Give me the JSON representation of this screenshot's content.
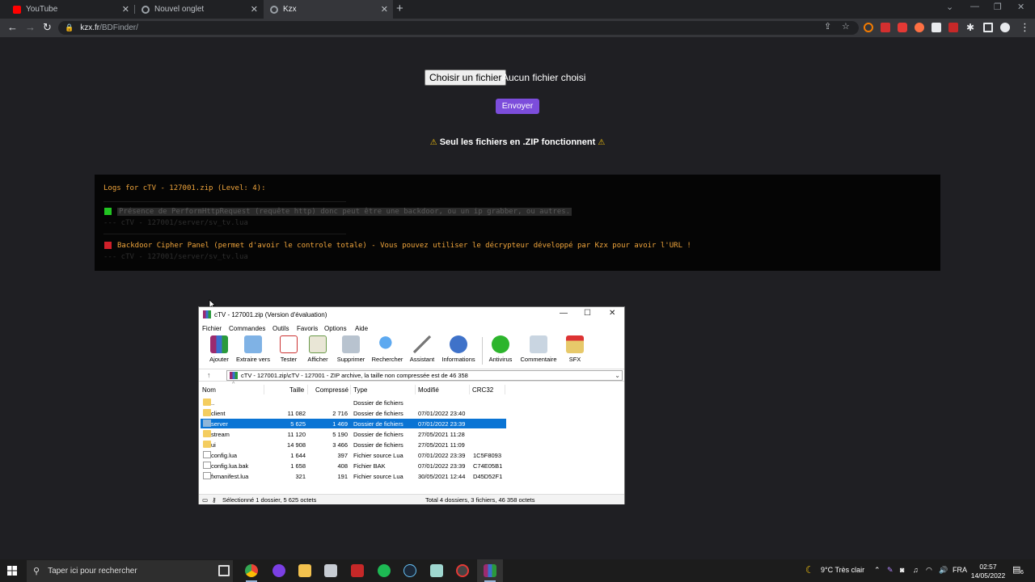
{
  "browser": {
    "tabs": [
      {
        "title": "YouTube",
        "color": "#ff0000"
      },
      {
        "title": "Nouvel onglet",
        "color": "#9aa0a6"
      },
      {
        "title": "Kzx",
        "color": "#9aa0a6"
      }
    ],
    "url_host": "kzx.fr",
    "url_path": "/BDFinder/"
  },
  "page": {
    "choose_file_label": "Choisir un fichier",
    "no_file_label": "Aucun fichier choisi",
    "submit_label": "Envoyer",
    "notice_pre": "Seul les fichiers en",
    "notice_ext": ".ZIP",
    "notice_post": "fonctionnent",
    "accent_color": "#7c4ddb",
    "logs": {
      "title": "Logs for cTV - 127001.zip (Level: 4):",
      "entries": [
        {
          "status": "green",
          "message": "Présence de PerformHttpRequest (requête http) donc peut être une backdoor, ou un ip grabber, ou autres.",
          "path": "--- cTV - 127001/server/sv_tv.lua"
        },
        {
          "status": "red",
          "message": "Backdoor Cipher Panel (permet d'avoir le controle totale) - Vous pouvez utiliser le décrypteur développé par Kzx pour avoir l'URL !",
          "path": "--- cTV - 127001/server/sv_tv.lua"
        }
      ]
    }
  },
  "winrar": {
    "title": "cTV - 127001.zip (Version d'évaluation)",
    "menu": [
      "Fichier",
      "Commandes",
      "Outils",
      "Favoris",
      "Options",
      "Aide"
    ],
    "tools": [
      "Ajouter",
      "Extraire vers",
      "Tester",
      "Afficher",
      "Supprimer",
      "Rechercher",
      "Assistant",
      "Informations",
      "Antivirus",
      "Commentaire",
      "SFX"
    ],
    "path": "cTV - 127001.zip\\cTV - 127001 - ZIP archive, la taille non compressée est de 46 358",
    "columns": [
      "Nom",
      "Taille",
      "Compressé",
      "Type",
      "Modifié",
      "CRC32"
    ],
    "rows": [
      {
        "name": "..",
        "size": "",
        "packed": "",
        "type": "Dossier de fichiers",
        "modified": "",
        "crc": "",
        "kind": "folder"
      },
      {
        "name": "client",
        "size": "11 082",
        "packed": "2 716",
        "type": "Dossier de fichiers",
        "modified": "07/01/2022 23:40",
        "crc": "",
        "kind": "folder"
      },
      {
        "name": "server",
        "size": "5 625",
        "packed": "1 469",
        "type": "Dossier de fichiers",
        "modified": "07/01/2022 23:39",
        "crc": "",
        "kind": "folder",
        "selected": true
      },
      {
        "name": "stream",
        "size": "11 120",
        "packed": "5 190",
        "type": "Dossier de fichiers",
        "modified": "27/05/2021 11:28",
        "crc": "",
        "kind": "folder"
      },
      {
        "name": "ui",
        "size": "14 908",
        "packed": "3 466",
        "type": "Dossier de fichiers",
        "modified": "27/05/2021 11:09",
        "crc": "",
        "kind": "folder"
      },
      {
        "name": "config.lua",
        "size": "1 644",
        "packed": "397",
        "type": "Fichier source Lua",
        "modified": "07/01/2022 23:39",
        "crc": "1C5F8093",
        "kind": "file"
      },
      {
        "name": "config.lua.bak",
        "size": "1 658",
        "packed": "408",
        "type": "Fichier BAK",
        "modified": "07/01/2022 23:39",
        "crc": "C74E05B1",
        "kind": "file"
      },
      {
        "name": "fxmanifest.lua",
        "size": "321",
        "packed": "191",
        "type": "Fichier source Lua",
        "modified": "30/05/2021 12:44",
        "crc": "D45D52F1",
        "kind": "file"
      }
    ],
    "status_left": "Sélectionné 1 dossier, 5 625 octets",
    "status_right": "Total 4 dossiers, 3 fichiers, 46 358 octets"
  },
  "taskbar": {
    "search_placeholder": "Taper ici pour rechercher",
    "weather": "9°C  Très clair",
    "lang": "FRA",
    "time": "02:57",
    "date": "14/05/2022",
    "notif_count": "6"
  }
}
